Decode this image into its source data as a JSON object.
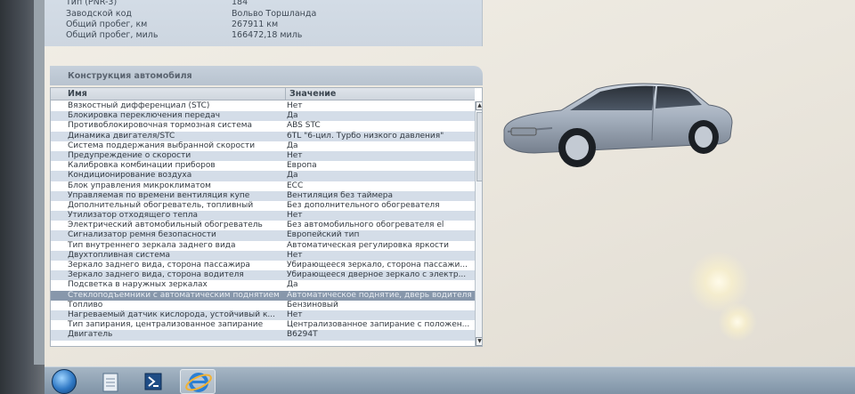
{
  "top_info": [
    {
      "key": "Тип (PNR-3)",
      "value": "184"
    },
    {
      "key": "Заводской код",
      "value": "Вольво Торшланда"
    },
    {
      "key": "Общий пробег, км",
      "value": "267911 км"
    },
    {
      "key": "Общий пробег, миль",
      "value": "166472,18 миль"
    }
  ],
  "section": {
    "title": "Конструкция автомобиля",
    "columns": {
      "name": "Имя",
      "value": "Значение"
    }
  },
  "rows": [
    {
      "name": "Вязкостный дифференциал (STC)",
      "value": "Нет"
    },
    {
      "name": "Блокировка переключения передач",
      "value": "Да"
    },
    {
      "name": "Противоблокировочная тормозная система",
      "value": "ABS STC"
    },
    {
      "name": "Динамика двигателя/STC",
      "value": "6TL \"6-цил. Турбо низкого давления\""
    },
    {
      "name": "Система поддержания выбранной скорости",
      "value": "Да"
    },
    {
      "name": "Предупреждение о скорости",
      "value": "Нет"
    },
    {
      "name": "Калибровка комбинации приборов",
      "value": "Европа"
    },
    {
      "name": "Кондиционирование воздуха",
      "value": "Да"
    },
    {
      "name": "Блок управления микроклиматом",
      "value": "ECC"
    },
    {
      "name": "Управляемая по времени вентиляция купе",
      "value": "Вентиляция без таймера"
    },
    {
      "name": "Дополнительный обогреватель, топливный",
      "value": "Без дополнительного обогревателя"
    },
    {
      "name": "Утилизатор отходящего тепла",
      "value": "Нет"
    },
    {
      "name": "Электрический автомобильный обогреватель",
      "value": "Без автомобильного обогревателя el"
    },
    {
      "name": "Сигнализатор ремня безопасности",
      "value": "Европейский тип"
    },
    {
      "name": "Тип внутреннего зеркала заднего вида",
      "value": "Автоматическая регулировка яркости"
    },
    {
      "name": "Двухтопливная система",
      "value": "Нет"
    },
    {
      "name": "Зеркало заднего вида, сторона пассажира",
      "value": "Убирающееся зеркало, сторона пассажи..."
    },
    {
      "name": "Зеркало заднего вида, сторона водителя",
      "value": "Убирающееся дверное зеркало с электр..."
    },
    {
      "name": "Подсветка в наружных зеркалах",
      "value": "Да"
    },
    {
      "name": "Стеклоподъемники с автоматическим поднятием",
      "value": "Автоматическое поднятие, дверь водителя"
    },
    {
      "name": "Топливо",
      "value": "Бензиновый"
    },
    {
      "name": "Нагреваемый датчик кислорода, устойчивый к...",
      "value": "Нет"
    },
    {
      "name": "Тип запирания, централизованное запирание",
      "value": "Централизованное запирание с положен..."
    },
    {
      "name": "Двигатель",
      "value": "B6294T"
    }
  ],
  "selected_row": 19,
  "colors": {
    "row_alt": "#d4dde8",
    "row_selected": "#8797ab",
    "header_panel": "#c6d0db",
    "car_body": "#aab4c2"
  },
  "icons": [
    "start-orb-icon",
    "notepad-icon",
    "powershell-icon",
    "internet-explorer-icon"
  ]
}
